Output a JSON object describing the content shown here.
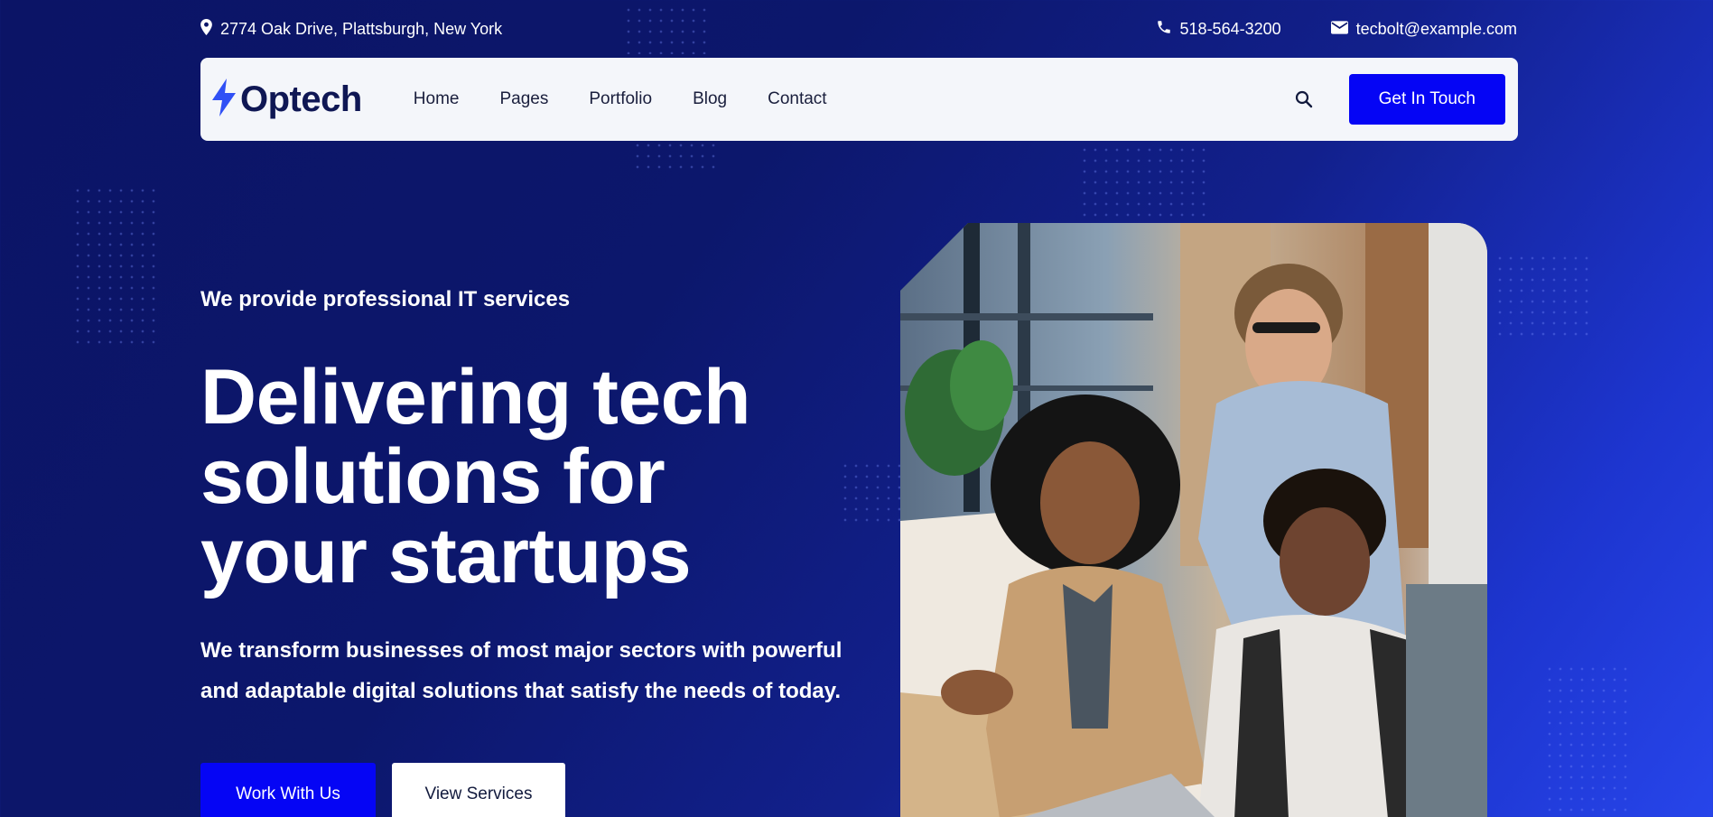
{
  "topbar": {
    "address": "2774 Oak Drive, Plattsburgh, New York",
    "phone": "518-564-3200",
    "email": "tecbolt@example.com"
  },
  "nav": {
    "logo_text": "Optech",
    "items": [
      "Home",
      "Pages",
      "Portfolio",
      "Blog",
      "Contact"
    ],
    "cta_label": "Get In Touch"
  },
  "hero": {
    "eyebrow": "We provide professional IT services",
    "headline_lines": [
      "Delivering tech",
      "solutions for",
      "your startups"
    ],
    "lead_lines": [
      "We transform businesses of most major sectors with powerful",
      "and adaptable digital solutions that satisfy the needs of today."
    ],
    "primary_button": "Work With Us",
    "secondary_button": "View Services"
  },
  "icons": {
    "address": "map-pin-icon",
    "phone": "phone-icon",
    "email": "envelope-icon",
    "search": "search-icon",
    "logo": "lightning-bolt-icon"
  },
  "colors": {
    "background": "#0c176c",
    "accent": "#0505f5",
    "logo_bolt": "#3050f5",
    "logo_text": "#0f1754",
    "nav_bg": "#f4f6fa"
  }
}
